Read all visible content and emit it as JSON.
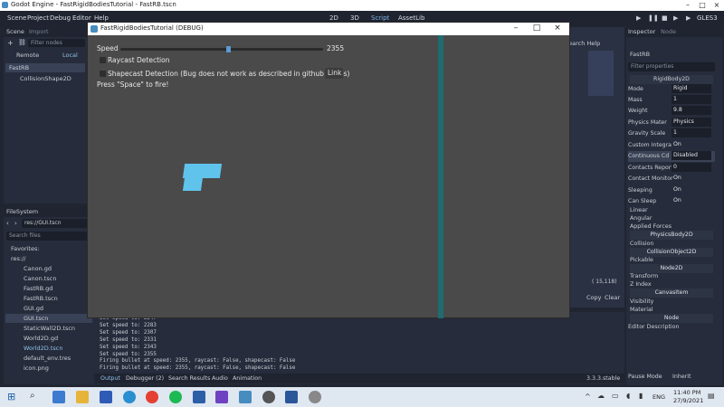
{
  "window": {
    "title": "Godot Engine - FastRigidBodiesTutorial - FastRB.tscn"
  },
  "menu": {
    "scene": "Scene",
    "project": "Project",
    "debug": "Debug",
    "editor": "Editor",
    "help": "Help",
    "view_2d": "2D",
    "view_3d": "3D",
    "view_script": "Script",
    "view_assetlib": "AssetLib",
    "renderer": "GLES3"
  },
  "scene_panel": {
    "tab_scene": "Scene",
    "tab_import": "Import",
    "filter_placeholder": "Filter nodes",
    "remote": "Remote",
    "local": "Local",
    "nodes": [
      "FastRB",
      "CollisionShape2D"
    ]
  },
  "filesystem": {
    "tab": "FileSystem",
    "path": "res://GUI.tscn",
    "search_placeholder": "Search files",
    "favorites": "Favorites:",
    "root": "res://",
    "files": [
      "Canon.gd",
      "Canon.tscn",
      "FastRB.gd",
      "FastRB.tscn",
      "GUI.gd",
      "GUI.tscn",
      "StaticWall2D.tscn",
      "World2D.gd",
      "World2D.tscn",
      "default_env.tres",
      "icon.png"
    ]
  },
  "debug_window": {
    "title": "FastRigidBodiesTutorial (DEBUG)",
    "speed_label": "Speed",
    "speed_value": "2355",
    "speed_fraction": 0.53,
    "raycast_label": "Raycast Detection",
    "shapecast_label": "Shapecast Detection (Bug does not work as described in github issues)",
    "link_button": "Link",
    "hint": "Press \"Space\" to fire!"
  },
  "editor_behind": {
    "search_help": "Search Help",
    "coords": "( 15,118)",
    "copy": "Copy",
    "clear": "Clear"
  },
  "output": {
    "lines": [
      "Set speed to: 2247",
      "Set speed to: 2283",
      "Set speed to: 2307",
      "Set speed to: 2331",
      "Set speed to: 2343",
      "Set speed to: 2355",
      "Firing bullet at speed: 2355, raycast: False, shapecast: False",
      "Firing bullet at speed: 2355, raycast: False, shapecast: False"
    ],
    "tabs": [
      "Output",
      "Debugger (2)",
      "Search Results",
      "Audio",
      "Animation"
    ],
    "version": "3.3.3.stable"
  },
  "inspector": {
    "tab_inspector": "Inspector",
    "tab_node": "Node",
    "node_name": "FastRB",
    "filter_placeholder": "Filter properties",
    "class_header": "RigidBody2D",
    "props": [
      {
        "k": "Mode",
        "v": "Rigid"
      },
      {
        "k": "Mass",
        "v": "1"
      },
      {
        "k": "Weight",
        "v": "9.8"
      },
      {
        "k": "Physics Mater",
        "v": "Physics"
      },
      {
        "k": "Gravity Scale",
        "v": "1"
      },
      {
        "k": "Custom Integra",
        "v": "On"
      },
      {
        "k": "Continuous Cd",
        "v": "Disabled"
      },
      {
        "k": "Contacts Report",
        "v": "0"
      },
      {
        "k": "Contact Monitor",
        "v": "On"
      },
      {
        "k": "Sleeping",
        "v": "On"
      },
      {
        "k": "Can Sleep",
        "v": "On"
      }
    ],
    "sections": [
      "Linear",
      "Angular",
      "Applied Forces"
    ],
    "physics_body": "PhysicsBody2D",
    "collision": "Collision",
    "collision_object": "CollisionObject2D",
    "pickable": "Pickable",
    "node2d": "Node2D",
    "transform": "Transform",
    "zindex": "Z Index",
    "canvas_item": "CanvasItem",
    "visibility": "Visibility",
    "material": "Material",
    "node": "Node",
    "editor_description": "Editor Description",
    "pause_mode": "Pause Mode",
    "pause_value": "Inherit"
  },
  "taskbar": {
    "lang": "ENG",
    "time": "11:40 PM",
    "date": "27/9/2021"
  },
  "colors": {
    "wall": "#1e6b70",
    "bullet": "#5fc3ec",
    "accent": "#5b9bd5"
  }
}
